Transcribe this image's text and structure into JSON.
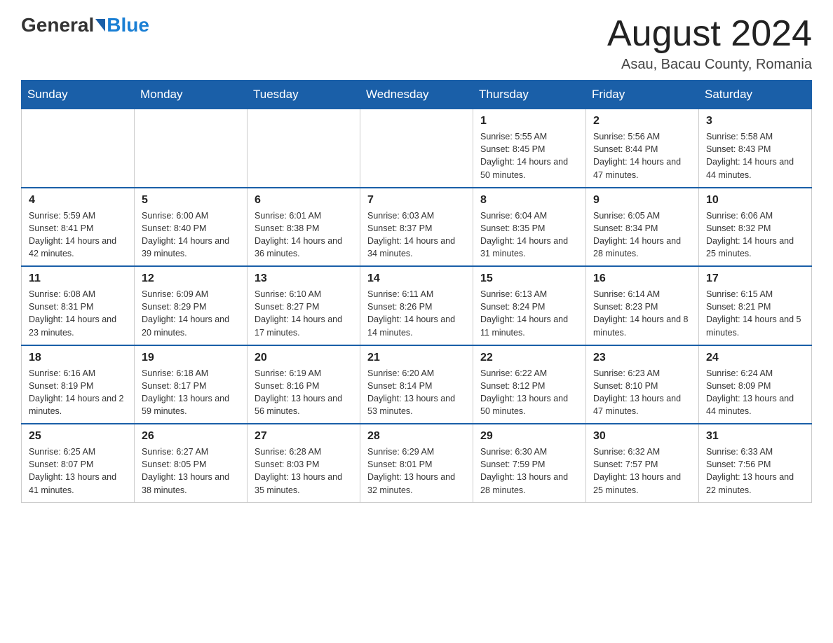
{
  "logo": {
    "general": "General",
    "blue": "Blue"
  },
  "title": "August 2024",
  "subtitle": "Asau, Bacau County, Romania",
  "days_header": [
    "Sunday",
    "Monday",
    "Tuesday",
    "Wednesday",
    "Thursday",
    "Friday",
    "Saturday"
  ],
  "weeks": [
    [
      {
        "day": "",
        "info": ""
      },
      {
        "day": "",
        "info": ""
      },
      {
        "day": "",
        "info": ""
      },
      {
        "day": "",
        "info": ""
      },
      {
        "day": "1",
        "info": "Sunrise: 5:55 AM\nSunset: 8:45 PM\nDaylight: 14 hours and 50 minutes."
      },
      {
        "day": "2",
        "info": "Sunrise: 5:56 AM\nSunset: 8:44 PM\nDaylight: 14 hours and 47 minutes."
      },
      {
        "day": "3",
        "info": "Sunrise: 5:58 AM\nSunset: 8:43 PM\nDaylight: 14 hours and 44 minutes."
      }
    ],
    [
      {
        "day": "4",
        "info": "Sunrise: 5:59 AM\nSunset: 8:41 PM\nDaylight: 14 hours and 42 minutes."
      },
      {
        "day": "5",
        "info": "Sunrise: 6:00 AM\nSunset: 8:40 PM\nDaylight: 14 hours and 39 minutes."
      },
      {
        "day": "6",
        "info": "Sunrise: 6:01 AM\nSunset: 8:38 PM\nDaylight: 14 hours and 36 minutes."
      },
      {
        "day": "7",
        "info": "Sunrise: 6:03 AM\nSunset: 8:37 PM\nDaylight: 14 hours and 34 minutes."
      },
      {
        "day": "8",
        "info": "Sunrise: 6:04 AM\nSunset: 8:35 PM\nDaylight: 14 hours and 31 minutes."
      },
      {
        "day": "9",
        "info": "Sunrise: 6:05 AM\nSunset: 8:34 PM\nDaylight: 14 hours and 28 minutes."
      },
      {
        "day": "10",
        "info": "Sunrise: 6:06 AM\nSunset: 8:32 PM\nDaylight: 14 hours and 25 minutes."
      }
    ],
    [
      {
        "day": "11",
        "info": "Sunrise: 6:08 AM\nSunset: 8:31 PM\nDaylight: 14 hours and 23 minutes."
      },
      {
        "day": "12",
        "info": "Sunrise: 6:09 AM\nSunset: 8:29 PM\nDaylight: 14 hours and 20 minutes."
      },
      {
        "day": "13",
        "info": "Sunrise: 6:10 AM\nSunset: 8:27 PM\nDaylight: 14 hours and 17 minutes."
      },
      {
        "day": "14",
        "info": "Sunrise: 6:11 AM\nSunset: 8:26 PM\nDaylight: 14 hours and 14 minutes."
      },
      {
        "day": "15",
        "info": "Sunrise: 6:13 AM\nSunset: 8:24 PM\nDaylight: 14 hours and 11 minutes."
      },
      {
        "day": "16",
        "info": "Sunrise: 6:14 AM\nSunset: 8:23 PM\nDaylight: 14 hours and 8 minutes."
      },
      {
        "day": "17",
        "info": "Sunrise: 6:15 AM\nSunset: 8:21 PM\nDaylight: 14 hours and 5 minutes."
      }
    ],
    [
      {
        "day": "18",
        "info": "Sunrise: 6:16 AM\nSunset: 8:19 PM\nDaylight: 14 hours and 2 minutes."
      },
      {
        "day": "19",
        "info": "Sunrise: 6:18 AM\nSunset: 8:17 PM\nDaylight: 13 hours and 59 minutes."
      },
      {
        "day": "20",
        "info": "Sunrise: 6:19 AM\nSunset: 8:16 PM\nDaylight: 13 hours and 56 minutes."
      },
      {
        "day": "21",
        "info": "Sunrise: 6:20 AM\nSunset: 8:14 PM\nDaylight: 13 hours and 53 minutes."
      },
      {
        "day": "22",
        "info": "Sunrise: 6:22 AM\nSunset: 8:12 PM\nDaylight: 13 hours and 50 minutes."
      },
      {
        "day": "23",
        "info": "Sunrise: 6:23 AM\nSunset: 8:10 PM\nDaylight: 13 hours and 47 minutes."
      },
      {
        "day": "24",
        "info": "Sunrise: 6:24 AM\nSunset: 8:09 PM\nDaylight: 13 hours and 44 minutes."
      }
    ],
    [
      {
        "day": "25",
        "info": "Sunrise: 6:25 AM\nSunset: 8:07 PM\nDaylight: 13 hours and 41 minutes."
      },
      {
        "day": "26",
        "info": "Sunrise: 6:27 AM\nSunset: 8:05 PM\nDaylight: 13 hours and 38 minutes."
      },
      {
        "day": "27",
        "info": "Sunrise: 6:28 AM\nSunset: 8:03 PM\nDaylight: 13 hours and 35 minutes."
      },
      {
        "day": "28",
        "info": "Sunrise: 6:29 AM\nSunset: 8:01 PM\nDaylight: 13 hours and 32 minutes."
      },
      {
        "day": "29",
        "info": "Sunrise: 6:30 AM\nSunset: 7:59 PM\nDaylight: 13 hours and 28 minutes."
      },
      {
        "day": "30",
        "info": "Sunrise: 6:32 AM\nSunset: 7:57 PM\nDaylight: 13 hours and 25 minutes."
      },
      {
        "day": "31",
        "info": "Sunrise: 6:33 AM\nSunset: 7:56 PM\nDaylight: 13 hours and 22 minutes."
      }
    ]
  ]
}
